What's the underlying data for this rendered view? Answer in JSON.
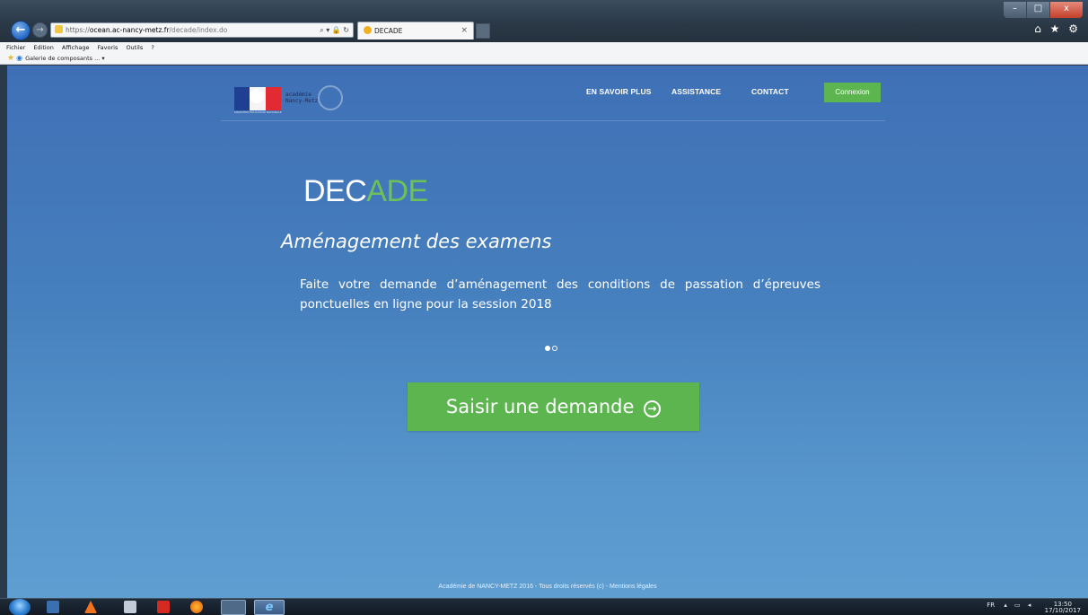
{
  "browser": {
    "url_protocol": "https://",
    "url_host": "ocean.ac-nancy-metz.fr",
    "url_path": "/decade/index.do",
    "address_tools": "⌕ ▾ 🔒 ↻",
    "tab_title": "DECADE",
    "tab_close": "×",
    "back_glyph": "←",
    "forward_glyph": "→",
    "window_minimize": "–",
    "window_maximize": "□",
    "window_close": "x",
    "toolbar_icons": "⌂ ★ ⚙",
    "menu": [
      "Fichier",
      "Edition",
      "Affichage",
      "Favoris",
      "Outils",
      "?"
    ],
    "favorites_item": "Galerie de composants ... ▾"
  },
  "header": {
    "logo_line1": "académie",
    "logo_line2": "Nancy-Metz",
    "logo_caption": "MINISTÈRE ÉDUCATION NATIONALE",
    "nav": [
      "EN SAVOIR PLUS",
      "ASSISTANCE",
      "CONTACT"
    ],
    "login_button": "Connexion"
  },
  "hero": {
    "title_part1": "DEC",
    "title_part2": "ADE",
    "subtitle": "Aménagement des examens",
    "description": "Faite votre demande d’aménagement des conditions de passation d’épreuves ponctuelles en ligne pour la session 2018",
    "carousel_current": 1,
    "carousel_total": 2,
    "cta_label": "Saisir une demande",
    "cta_icon": "→"
  },
  "footer": {
    "text": "Académie de NANCY-METZ 2016 - Tous droits réservés (c) - Mentions légales"
  },
  "taskbar": {
    "lang": "FR",
    "tray_icons": "▴ ▭ ◂",
    "time": "13:50",
    "date": "17/10/2017",
    "ie_glyph": "e"
  },
  "colors": {
    "accent_green": "#5db550",
    "title_green": "#6cc15a",
    "background_blue": "#4680be"
  }
}
